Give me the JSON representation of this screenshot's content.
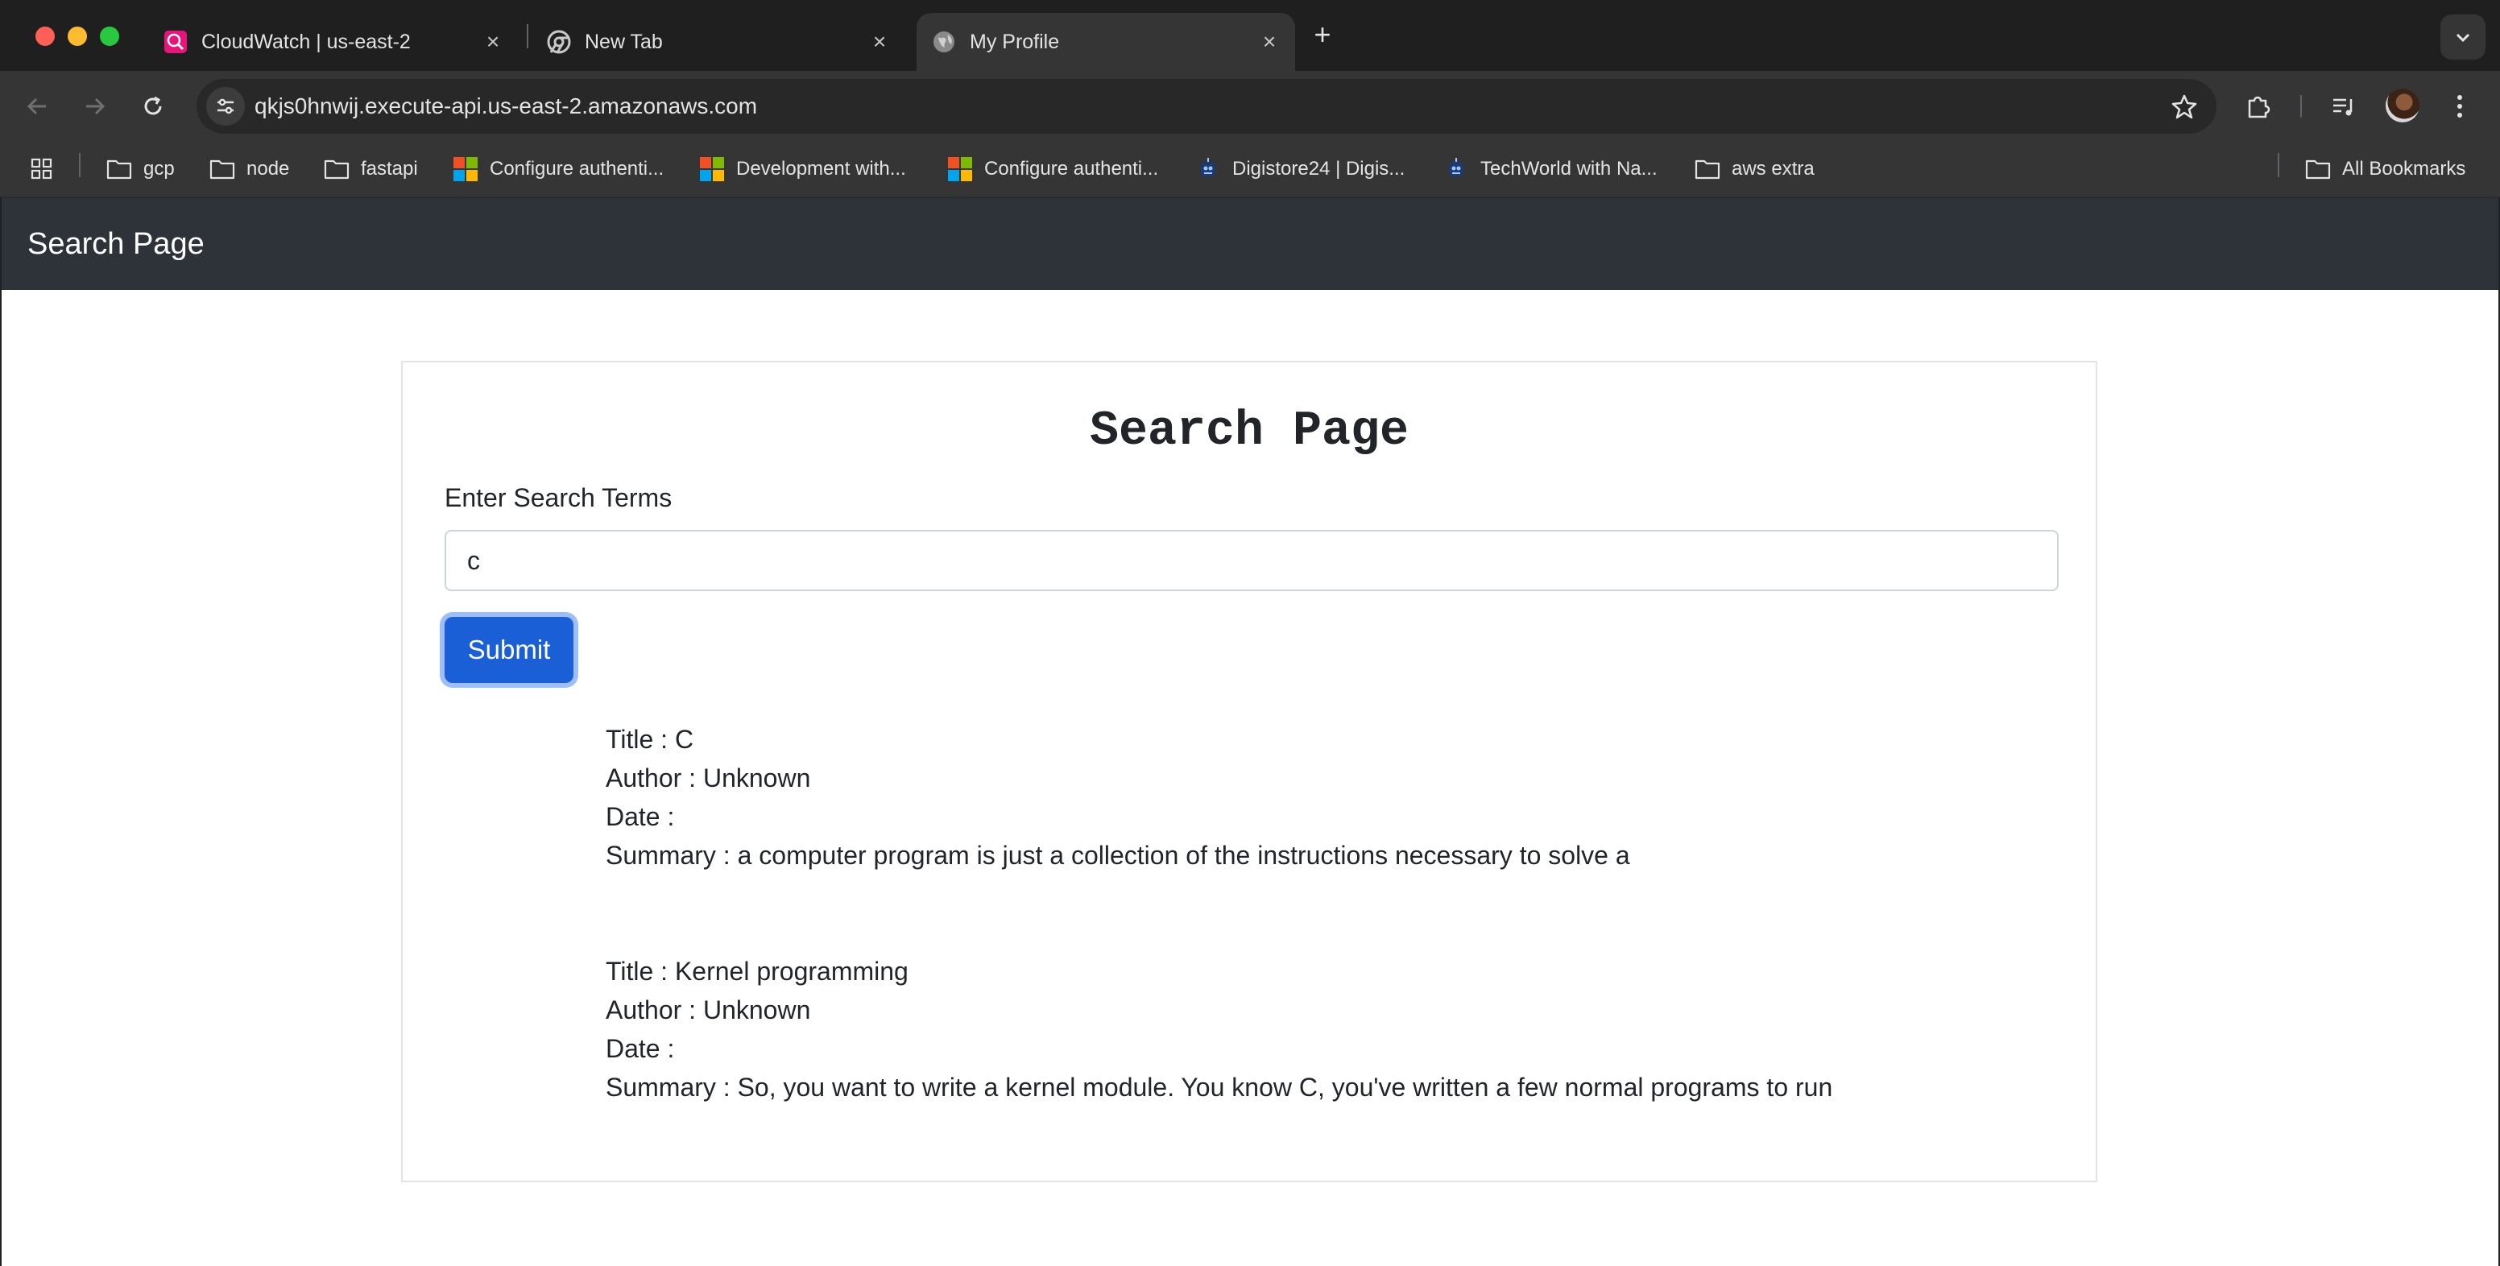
{
  "browser": {
    "tabs": [
      {
        "title": "CloudWatch | us-east-2",
        "favicon": "cloudwatch-icon",
        "active": false
      },
      {
        "title": "New Tab",
        "favicon": "chrome-icon",
        "active": false
      },
      {
        "title": "My Profile",
        "favicon": "globe-icon",
        "active": true
      }
    ],
    "address": "qkjs0hnwij.execute-api.us-east-2.amazonaws.com",
    "bookmarks": [
      {
        "label": "gcp",
        "icon": "folder-icon"
      },
      {
        "label": "node",
        "icon": "folder-icon"
      },
      {
        "label": "fastapi",
        "icon": "folder-icon"
      },
      {
        "label": "Configure authenti...",
        "icon": "microsoft-icon"
      },
      {
        "label": "Development with...",
        "icon": "microsoft-icon"
      },
      {
        "label": "Configure authenti...",
        "icon": "microsoft-icon"
      },
      {
        "label": "Digistore24 | Digis...",
        "icon": "robot-icon"
      },
      {
        "label": "TechWorld with Na...",
        "icon": "robot-icon"
      },
      {
        "label": "aws extra",
        "icon": "folder-icon"
      }
    ],
    "all_bookmarks": "All Bookmarks"
  },
  "page": {
    "navbar_brand": "Search Page",
    "heading": "Search Page",
    "search_label": "Enter Search Terms",
    "search_value": "c",
    "submit_label": "Submit",
    "results": [
      {
        "title": "Title : C",
        "author": "Author : Unknown",
        "date": "Date :",
        "summary": "Summary : a computer program is just a collection of the instructions necessary to solve a"
      },
      {
        "title": "Title : Kernel programming",
        "author": "Author : Unknown",
        "date": "Date :",
        "summary": "Summary : So, you want to write a kernel module. You know C, you've written a few normal programs to run"
      }
    ]
  },
  "colors": {
    "navbar_bg": "#2d3338",
    "submit_bg": "#1a5fd6",
    "text": "#212529"
  }
}
